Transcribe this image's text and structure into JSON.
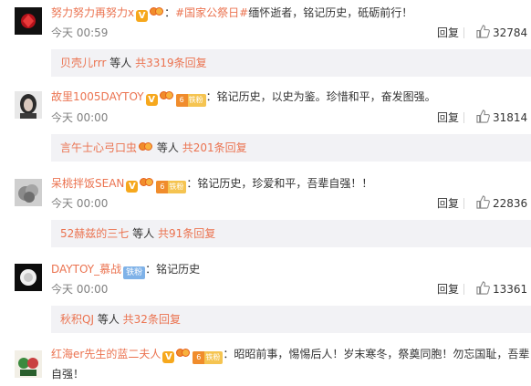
{
  "ui": {
    "reply_label": "回复",
    "people_suffix": "等人"
  },
  "comments": [
    {
      "username": "努力努力再努力x",
      "topic": "#国家公祭日#",
      "text": "缅怀逝者，铭记历史，砥砺前行！",
      "time": "今天 00:59",
      "likes": "32784",
      "subreply": {
        "user": "贝壳儿rrr",
        "count": "共3319条回复"
      }
    },
    {
      "username": "故里1005DAYTOY",
      "fan_badge": "铁粉",
      "text": "：铭记历史，以史为鉴。珍惜和平，奋发图强。",
      "time": "今天 00:00",
      "likes": "31814",
      "subreply": {
        "user": "言午士心弓口虫",
        "count": "共201条回复"
      }
    },
    {
      "username": "呆桃拌饭SEAN",
      "fan_badge": "铁粉",
      "text": "：铭记历史，珍爱和平，吾辈自强！！",
      "time": "今天 00:00",
      "likes": "22836",
      "subreply": {
        "user": "52赫兹的三七",
        "count": "共91条回复"
      }
    },
    {
      "username": "DAYTOY_慕战",
      "fan_badge": "铁粉",
      "text": "：铭记历史",
      "time": "今天 00:00",
      "likes": "13361",
      "subreply": {
        "user": "秋积QJ",
        "count": "共32条回复"
      }
    },
    {
      "username": "红海er先生的蓝二夫人",
      "fan_badge": "铁粉",
      "text": "：昭昭前事，惕惕后人！岁末寒冬，祭奠同胞！勿忘国耻，吾辈",
      "text_cont": "自强！"
    }
  ]
}
